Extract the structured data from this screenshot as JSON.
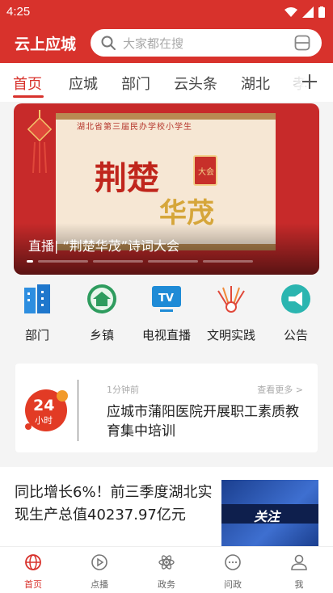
{
  "status": {
    "time": "4:25"
  },
  "header": {
    "title": "云上应城",
    "search_placeholder": "大家都在搜"
  },
  "tabs": [
    "首页",
    "应城",
    "部门",
    "云头条",
    "湖北",
    "孝"
  ],
  "banner": {
    "caption": "直播| “荆楚华茂”诗词大会",
    "scroll_line": "湖北省第三届民办学校小学生",
    "big_word_1": "荆楚",
    "big_word_2": "华茂",
    "badge_text": "大会"
  },
  "quick": [
    {
      "label": "部门",
      "icon": "building-icon"
    },
    {
      "label": "乡镇",
      "icon": "town-icon"
    },
    {
      "label": "电视直播",
      "icon": "tv-icon"
    },
    {
      "label": "文明实践",
      "icon": "civilization-icon"
    },
    {
      "label": "公告",
      "icon": "announcement-icon"
    }
  ],
  "card24": {
    "logo_number": "24",
    "logo_text": "小时",
    "ago": "1分钟前",
    "more": "查看更多 >",
    "headline": "应城市蒲阳医院开展职工素质教育集中培训"
  },
  "news": {
    "title": "同比增长6%！前三季度湖北实现生产总值40237.97亿元",
    "thumb_label": "关注"
  },
  "bottom_nav": [
    {
      "label": "首页",
      "icon": "home-globe-icon",
      "active": true
    },
    {
      "label": "点播",
      "icon": "play-icon",
      "active": false
    },
    {
      "label": "政务",
      "icon": "atom-icon",
      "active": false
    },
    {
      "label": "问政",
      "icon": "chat-icon",
      "active": false
    },
    {
      "label": "我",
      "icon": "person-icon",
      "active": false
    }
  ],
  "colors": {
    "brand_red": "#d8322c",
    "tv_blue": "#1f8bd6",
    "teal": "#2bb5b0"
  }
}
